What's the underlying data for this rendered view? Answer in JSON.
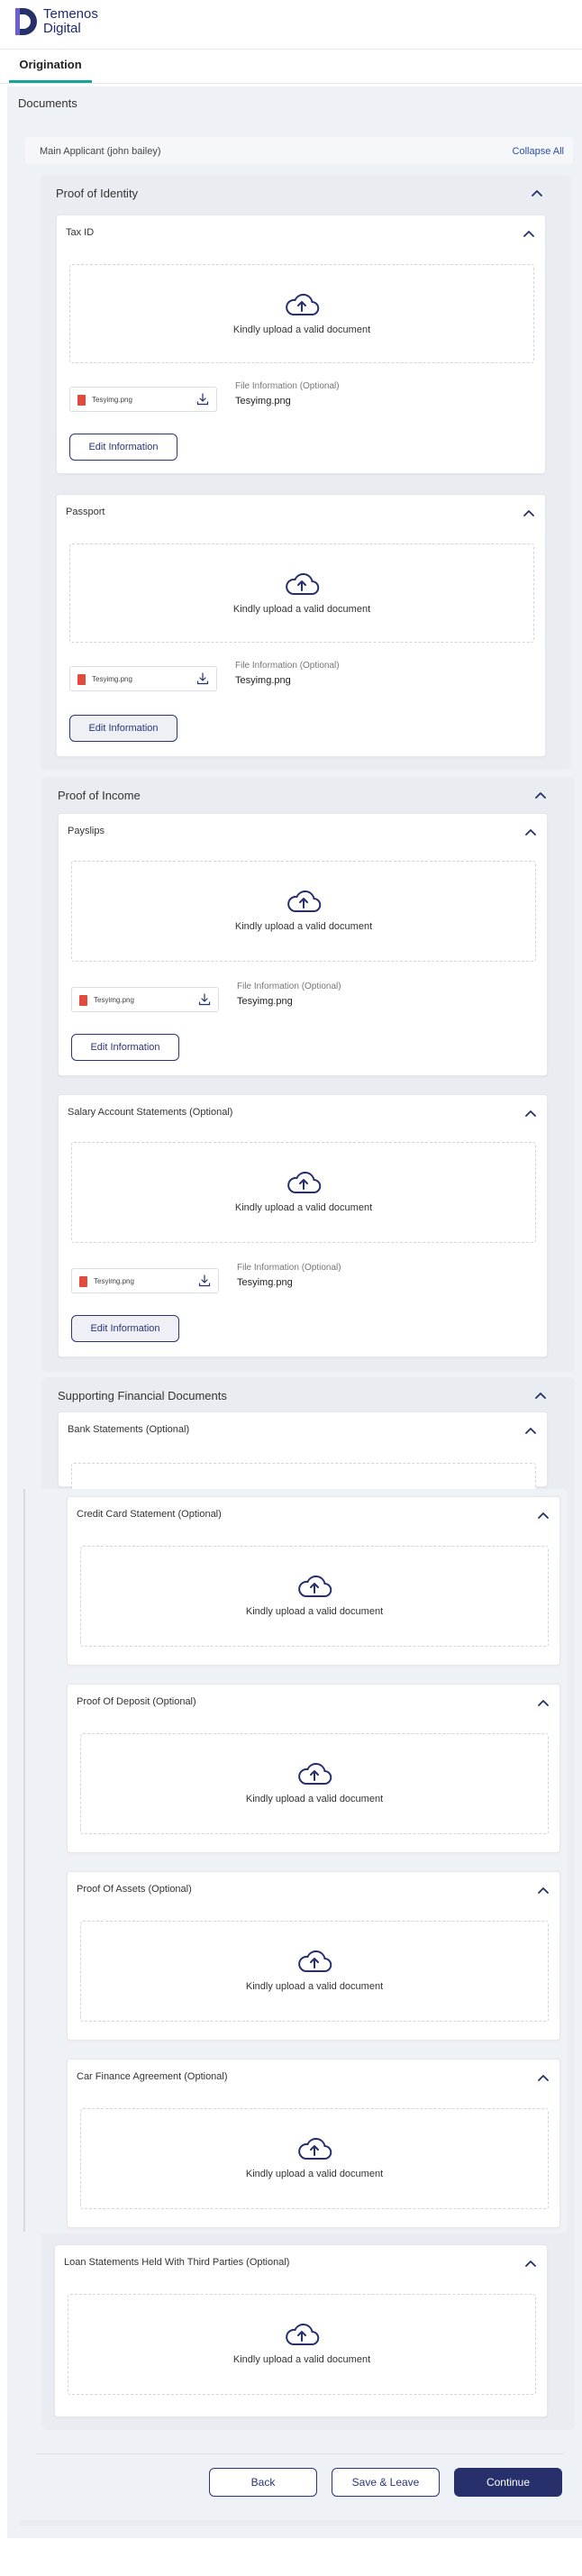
{
  "brand": {
    "line1": "Temenos",
    "line2": "Digital"
  },
  "tabs": [
    {
      "label": "Origination"
    }
  ],
  "documents_title": "Documents",
  "applicant": {
    "name": "Main Applicant (john bailey)",
    "collapse_all": "Collapse All"
  },
  "upload_text": "Kindly upload a valid document",
  "file_info_label": "File Information (Optional)",
  "edit_label": "Edit Information",
  "sections": [
    {
      "title": "Proof of Identity",
      "cards": [
        {
          "title": "Tax ID",
          "file_name": "Tesyimg.png",
          "file_info": "Tesyimg.png"
        },
        {
          "title": "Passport",
          "file_name": "Tesyimg.png",
          "file_info": "Tesyimg.png"
        }
      ]
    },
    {
      "title": "Proof of Income",
      "cards": [
        {
          "title": "Payslips",
          "file_name": "Tesyimg.png",
          "file_info": "Tesyimg.png"
        },
        {
          "title": "Salary Account Statements (Optional)",
          "file_name": "Tesyimg.png",
          "file_info": "Tesyimg.png"
        }
      ]
    },
    {
      "title": "Supporting Financial Documents",
      "cards": [
        {
          "title": "Bank Statements (Optional)"
        },
        {
          "title": "Credit Card Statement (Optional)"
        },
        {
          "title": "Proof Of Deposit (Optional)"
        },
        {
          "title": "Proof Of Assets (Optional)"
        },
        {
          "title": "Car Finance Agreement (Optional)"
        },
        {
          "title": "Loan Statements Held With Third Parties (Optional)"
        }
      ]
    }
  ],
  "footer": {
    "back": "Back",
    "save_leave": "Save & Leave",
    "continue": "Continue"
  },
  "colors": {
    "primary": "#27306b",
    "accent": "#16a39a",
    "link": "#2b4ea8"
  }
}
